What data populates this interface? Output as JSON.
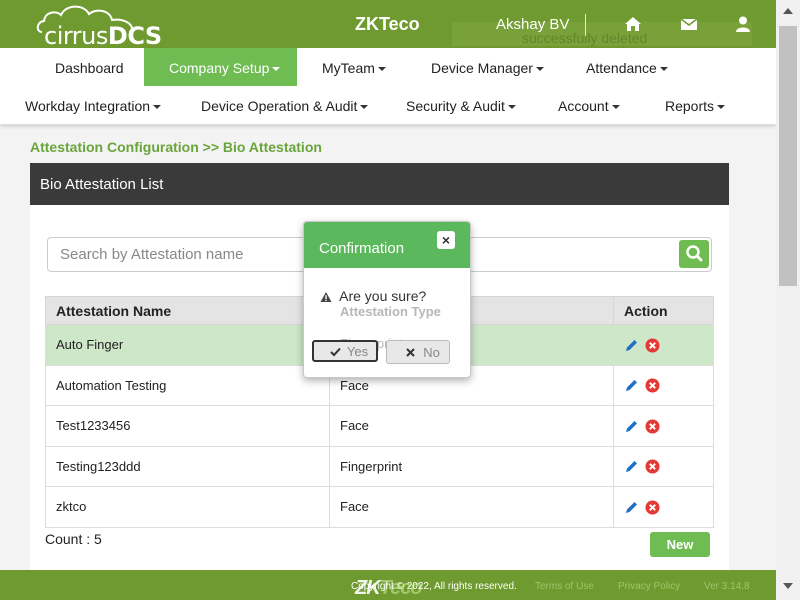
{
  "header": {
    "logo_text": "cirrus",
    "logo_text_bold": "DCS",
    "brand": "ZKTeco",
    "user": "Akshay BV",
    "notification_ghost": "successfully deleted"
  },
  "nav": {
    "row1": [
      {
        "label": "Dashboard",
        "dropdown": false
      },
      {
        "label": "Company Setup",
        "dropdown": true,
        "active": true
      },
      {
        "label": "MyTeam",
        "dropdown": true
      },
      {
        "label": "Device Manager",
        "dropdown": true
      },
      {
        "label": "Attendance",
        "dropdown": true
      }
    ],
    "row2": [
      {
        "label": "Workday Integration",
        "dropdown": true
      },
      {
        "label": "Device Operation & Audit",
        "dropdown": true
      },
      {
        "label": "Security & Audit",
        "dropdown": true
      },
      {
        "label": "Account",
        "dropdown": true
      },
      {
        "label": "Reports",
        "dropdown": true
      }
    ]
  },
  "breadcrumb": "Attestation Configuration >> Bio Attestation",
  "panel": {
    "title": "Bio Attestation List",
    "search_placeholder": "Search by Attestation name",
    "columns": [
      "Attestation Name",
      "Attestation Type",
      "Action"
    ],
    "rows": [
      {
        "name": "Auto Finger",
        "type": "Fingerprint",
        "highlight": true
      },
      {
        "name": "Automation Testing",
        "type": "Face"
      },
      {
        "name": "Test1233456",
        "type": "Face"
      },
      {
        "name": "Testing123ddd",
        "type": "Fingerprint"
      },
      {
        "name": "zktco",
        "type": "Face"
      }
    ],
    "count_label": "Count : 5",
    "new_button": "New"
  },
  "modal": {
    "title": "Confirmation",
    "message": "Are you sure?",
    "yes_label": "Yes",
    "no_label": "No",
    "close_glyph": "×"
  },
  "footer": {
    "copyright": "Copyright © 2022, All rights reserved.",
    "terms": "Terms of Use",
    "privacy": "Privacy Policy",
    "version": "Ver 3.14.8",
    "logo_zk": "ZK",
    "logo_teco": "Teco"
  },
  "colors": {
    "header_green": "#6f9a2f",
    "accent_green": "#6fbd52",
    "modal_green": "#5cb85c",
    "panel_header": "#3a3a3a",
    "edit_icon": "#1f6fc6",
    "delete_icon": "#e53935"
  },
  "icons": [
    "cloud-logo-icon",
    "home-icon",
    "mail-icon",
    "user-icon",
    "search-icon",
    "edit-icon",
    "delete-icon",
    "warning-icon",
    "check-icon",
    "times-icon",
    "close-icon"
  ]
}
